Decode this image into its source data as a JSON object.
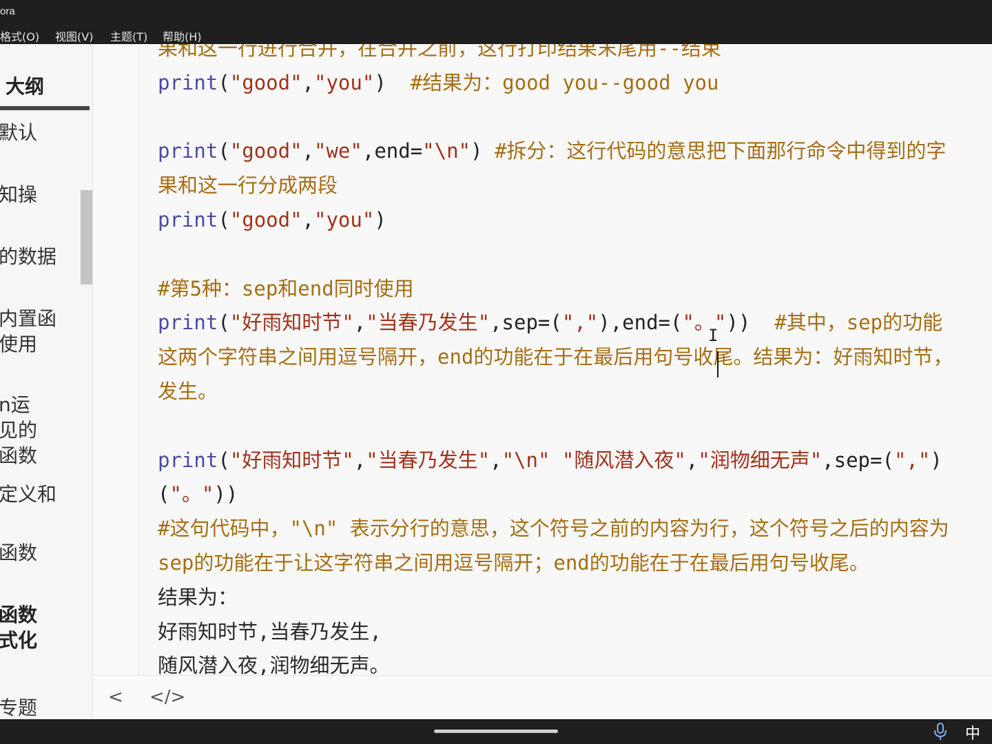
{
  "window": {
    "title": "ora"
  },
  "menu": [
    "格式(O)",
    "视图(V)",
    "主题(T)",
    "帮助(H)"
  ],
  "sidebar": {
    "title": "大纲",
    "items": [
      {
        "text": "默认",
        "bold": false
      },
      {
        "text": "知操",
        "bold": false
      },
      {
        "text": "的数据",
        "bold": false
      },
      {
        "text": "内置函\n使用",
        "bold": false
      },
      {
        "text": "n运\n见的\n函数",
        "bold": false
      },
      {
        "text": "定义和",
        "bold": false
      },
      {
        "text": "函数",
        "bold": false
      },
      {
        "text": "函数\n式化",
        "bold": true
      },
      {
        "text": "专题",
        "bold": false
      }
    ]
  },
  "editor": {
    "lines": [
      [
        {
          "t": "cm",
          "v": "果和这一行进行合并，在合并之前，这行打印结果末尾用--结束"
        }
      ],
      [
        {
          "t": "kw",
          "v": "print"
        },
        {
          "t": "pn",
          "v": "("
        },
        {
          "t": "str",
          "v": "\"good\""
        },
        {
          "t": "pn",
          "v": ","
        },
        {
          "t": "str",
          "v": "\"you\""
        },
        {
          "t": "pn",
          "v": ")  "
        },
        {
          "t": "cm",
          "v": "#结果为：good you--good you"
        }
      ],
      [],
      [
        {
          "t": "kw",
          "v": "print"
        },
        {
          "t": "pn",
          "v": "("
        },
        {
          "t": "str",
          "v": "\"good\""
        },
        {
          "t": "pn",
          "v": ","
        },
        {
          "t": "str",
          "v": "\"we\""
        },
        {
          "t": "pn",
          "v": ",end="
        },
        {
          "t": "str",
          "v": "\"\\n\""
        },
        {
          "t": "pn",
          "v": ") "
        },
        {
          "t": "cm",
          "v": "#拆分：这行代码的意思把下面那行命令中得到的字"
        }
      ],
      [
        {
          "t": "cm",
          "v": "果和这一行分成两段"
        }
      ],
      [
        {
          "t": "kw",
          "v": "print"
        },
        {
          "t": "pn",
          "v": "("
        },
        {
          "t": "str",
          "v": "\"good\""
        },
        {
          "t": "pn",
          "v": ","
        },
        {
          "t": "str",
          "v": "\"you\""
        },
        {
          "t": "pn",
          "v": ")"
        }
      ],
      [],
      [
        {
          "t": "cm",
          "v": "#第5种：sep和end同时使用"
        }
      ],
      [
        {
          "t": "kw",
          "v": "print"
        },
        {
          "t": "pn",
          "v": "("
        },
        {
          "t": "str",
          "v": "\"好雨知时节\""
        },
        {
          "t": "pn",
          "v": ","
        },
        {
          "t": "str",
          "v": "\"当春乃发生\""
        },
        {
          "t": "pn",
          "v": ",sep=("
        },
        {
          "t": "str",
          "v": "\",\""
        },
        {
          "t": "pn",
          "v": "),end=("
        },
        {
          "t": "str",
          "v": "\"。\""
        },
        {
          "t": "pn",
          "v": "))  "
        },
        {
          "t": "cm",
          "v": "#其中，sep的功能"
        }
      ],
      [
        {
          "t": "cm",
          "v": "这两个字符串之间用逗号隔开，end的功能在于在最后用句号收尾。结果为：好雨知时节，"
        }
      ],
      [
        {
          "t": "cm",
          "v": "发生。"
        }
      ],
      [],
      [
        {
          "t": "kw",
          "v": "print"
        },
        {
          "t": "pn",
          "v": "("
        },
        {
          "t": "str",
          "v": "\"好雨知时节\""
        },
        {
          "t": "pn",
          "v": ","
        },
        {
          "t": "str",
          "v": "\"当春乃发生\""
        },
        {
          "t": "pn",
          "v": ","
        },
        {
          "t": "str",
          "v": "\"\\n\" \"随风潜入夜\""
        },
        {
          "t": "pn",
          "v": ","
        },
        {
          "t": "str",
          "v": "\"润物细无声\""
        },
        {
          "t": "pn",
          "v": ",sep=("
        },
        {
          "t": "str",
          "v": "\",\""
        },
        {
          "t": "pn",
          "v": ")"
        }
      ],
      [
        {
          "t": "pn",
          "v": "("
        },
        {
          "t": "str",
          "v": "\"。\""
        },
        {
          "t": "pn",
          "v": "))"
        }
      ],
      [
        {
          "t": "cm",
          "v": "#这句代码中，\"\\n\" 表示分行的意思，这个符号之前的内容为行，这个符号之后的内容为"
        }
      ],
      [
        {
          "t": "cm",
          "v": "sep的功能在于让这字符串之间用逗号隔开；end的功能在于在最后用句号收尾。"
        }
      ],
      [
        {
          "t": "plain",
          "v": "结果为："
        }
      ],
      [
        {
          "t": "plain",
          "v": "好雨知时节,当春乃发生,"
        }
      ],
      [
        {
          "t": "plain",
          "v": "随风潜入夜,润物细无声。"
        }
      ]
    ]
  },
  "statusbar": {
    "back_label": "<",
    "source_label": "</>"
  },
  "taskbar": {
    "ime_label": "中"
  }
}
